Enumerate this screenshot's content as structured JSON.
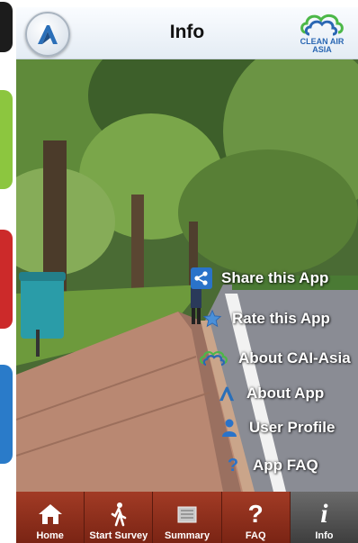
{
  "header": {
    "title": "Info",
    "logo_text_line1": "CLEAN AIR",
    "logo_text_line2": "ASIA"
  },
  "menu": [
    {
      "label": "Share this App",
      "icon": "share-icon"
    },
    {
      "label": "Rate this App",
      "icon": "star-icon"
    },
    {
      "label": "About CAI-Asia",
      "icon": "clean-air-asia-icon"
    },
    {
      "label": "About App",
      "icon": "app-logo-icon"
    },
    {
      "label": "User Profile",
      "icon": "user-icon"
    },
    {
      "label": "App FAQ",
      "icon": "question-icon"
    }
  ],
  "tabs": [
    {
      "label": "Home",
      "icon": "home-icon"
    },
    {
      "label": "Start Survey",
      "icon": "walking-icon"
    },
    {
      "label": "Summary",
      "icon": "summary-icon"
    },
    {
      "label": "FAQ",
      "icon": "question-icon"
    },
    {
      "label": "Info",
      "icon": "info-icon",
      "active": true
    }
  ],
  "colors": {
    "tab_bar": "#8e2e1b",
    "tab_active": "#4f4f4f",
    "share_icon_bg": "#2a73c9",
    "brand_blue": "#2a67b3",
    "brand_green": "#4cb848"
  }
}
